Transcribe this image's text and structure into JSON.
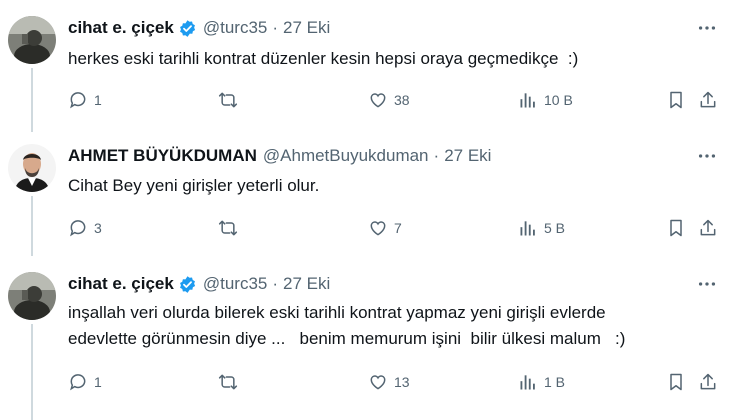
{
  "tweets": [
    {
      "name": "cihat e. çiçek",
      "verified": true,
      "handle": "@turc35",
      "separator": "·",
      "date": "27 Eki",
      "text": "herkes eski tarihli kontrat düzenler kesin hepsi oraya geçmedikçe  :)",
      "replies": "1",
      "retweets": "",
      "likes": "38",
      "views": "10 B"
    },
    {
      "name": "AHMET BÜYÜKDUMAN",
      "verified": false,
      "handle": "@AhmetBuyukduman",
      "separator": "·",
      "date": "27 Eki",
      "text": "Cihat Bey yeni girişler yeterli olur.",
      "replies": "3",
      "retweets": "",
      "likes": "7",
      "views": "5 B"
    },
    {
      "name": "cihat e. çiçek",
      "verified": true,
      "handle": "@turc35",
      "separator": "·",
      "date": "27 Eki",
      "text": "inşallah veri olurda bilerek eski tarihli kontrat yapmaz yeni girişli evlerde\nedevlette görünmesin diye ...   benim memurum işini  bilir ülkesi malum   :)",
      "replies": "1",
      "retweets": "",
      "likes": "13",
      "views": "1 B"
    }
  ],
  "colors": {
    "text": "#0f1419",
    "secondary": "#536471",
    "verified": "#1d9bf0",
    "thread_line": "#cfd9de"
  },
  "icons": [
    "reply-icon",
    "retweet-icon",
    "like-icon",
    "views-icon",
    "bookmark-icon",
    "share-icon",
    "more-icon",
    "verified-badge-icon"
  ]
}
